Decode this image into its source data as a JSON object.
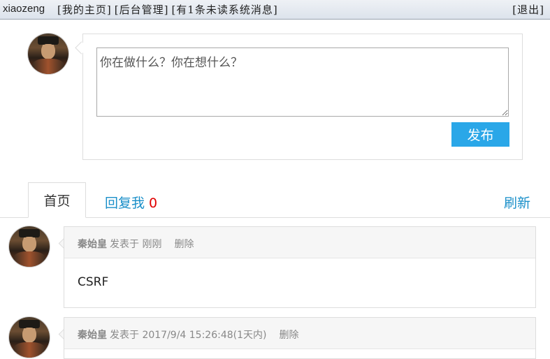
{
  "topbar": {
    "username": "xiaozeng",
    "links": [
      "[我的主页]",
      "[后台管理]",
      "[有1条未读系统消息]"
    ],
    "logout": "[退出]"
  },
  "composer": {
    "placeholder": "你在做什么？你在想什么？",
    "publish_label": "发布"
  },
  "tabs": {
    "home_label": "首页",
    "reply_label": "回复我",
    "reply_count": "0",
    "refresh_label": "刷新"
  },
  "posts": [
    {
      "author": "秦始皇",
      "time": "发表于 刚刚",
      "delete_label": "删除",
      "content": "CSRF"
    },
    {
      "author": "秦始皇",
      "time": "发表于 2017/9/4 15:26:48(1天内)",
      "delete_label": "删除",
      "content": ""
    }
  ],
  "colors": {
    "accent": "#2aa7e8",
    "link": "#1a8fc9",
    "count": "#e00000"
  }
}
